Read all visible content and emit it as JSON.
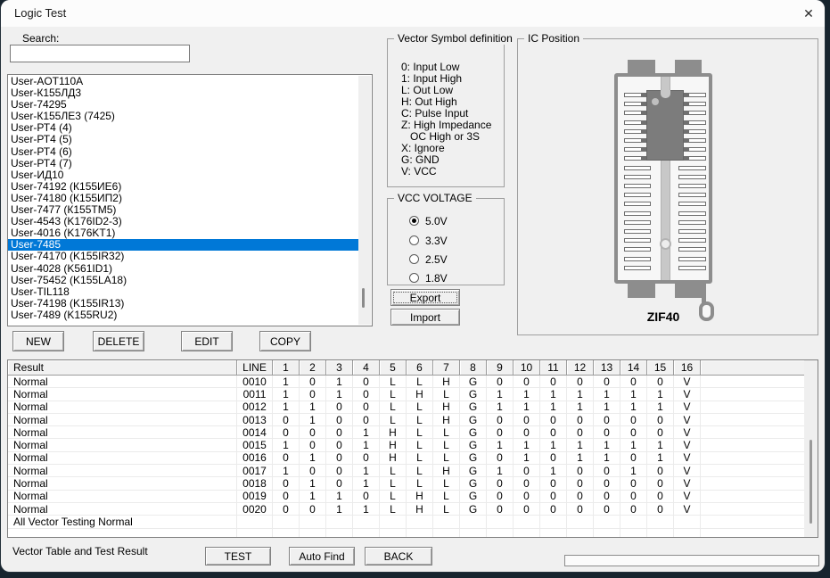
{
  "window": {
    "title": "Logic Test",
    "close_icon": "✕"
  },
  "search": {
    "label": "Search:",
    "value": ""
  },
  "chip_list": {
    "selected_index": 14,
    "items": [
      "User-AOT110A",
      "User-К155ЛД3",
      "User-74295",
      "User-К155ЛЕ3 (7425)",
      "User-РТ4 (4)",
      "User-РТ4 (5)",
      "User-РТ4 (6)",
      "User-РТ4 (7)",
      "User-ИД10",
      "User-74192 (К155ИЕ6)",
      "User-74180 (К155ИП2)",
      "User-7477 (К155ТМ5)",
      "User-4543 (K176ID2-3)",
      "User-4016 (K176KT1)",
      "User-7485",
      "User-74170 (K155IR32)",
      "User-4028 (K561ID1)",
      "User-75452 (K155LA18)",
      "User-TIL118",
      "User-74198 (K155IR13)",
      "User-7489 (K155RU2)"
    ]
  },
  "list_actions": {
    "new": "NEW",
    "delete": "DELETE",
    "edit": "EDIT",
    "copy": "COPY"
  },
  "vector_symbols": {
    "title": "Vector Symbol definition",
    "lines": [
      "0: Input Low",
      "1: Input High",
      "L: Out Low",
      "H: Out High",
      "C: Pulse Input",
      "Z: High Impedance",
      "   OC High or 3S",
      "X: Ignore",
      "G: GND",
      "V: VCC"
    ]
  },
  "vcc": {
    "title": "VCC VOLTAGE",
    "options": [
      "5.0V",
      "3.3V",
      "2.5V",
      "1.8V"
    ],
    "selected": "5.0V"
  },
  "io_buttons": {
    "export": "Export",
    "import": "Import"
  },
  "ic_position": {
    "title": "IC Position",
    "socket_label": "ZIF40",
    "pins_per_side": 20,
    "chip_pin_rows": 8
  },
  "vector_table": {
    "result_header": "Result",
    "line_header": "LINE",
    "pin_headers": [
      "1",
      "2",
      "3",
      "4",
      "5",
      "6",
      "7",
      "8",
      "9",
      "10",
      "11",
      "12",
      "13",
      "14",
      "15",
      "16"
    ],
    "rows": [
      {
        "result": "Normal",
        "line": "0010",
        "values": [
          "1",
          "0",
          "1",
          "0",
          "L",
          "L",
          "H",
          "G",
          "0",
          "0",
          "0",
          "0",
          "0",
          "0",
          "0",
          "V"
        ]
      },
      {
        "result": "Normal",
        "line": "0011",
        "values": [
          "1",
          "0",
          "1",
          "0",
          "L",
          "H",
          "L",
          "G",
          "1",
          "1",
          "1",
          "1",
          "1",
          "1",
          "1",
          "V"
        ]
      },
      {
        "result": "Normal",
        "line": "0012",
        "values": [
          "1",
          "1",
          "0",
          "0",
          "L",
          "L",
          "H",
          "G",
          "1",
          "1",
          "1",
          "1",
          "1",
          "1",
          "1",
          "V"
        ]
      },
      {
        "result": "Normal",
        "line": "0013",
        "values": [
          "0",
          "1",
          "0",
          "0",
          "L",
          "L",
          "H",
          "G",
          "0",
          "0",
          "0",
          "0",
          "0",
          "0",
          "0",
          "V"
        ]
      },
      {
        "result": "Normal",
        "line": "0014",
        "values": [
          "0",
          "0",
          "0",
          "1",
          "H",
          "L",
          "L",
          "G",
          "0",
          "0",
          "0",
          "0",
          "0",
          "0",
          "0",
          "V"
        ]
      },
      {
        "result": "Normal",
        "line": "0015",
        "values": [
          "1",
          "0",
          "0",
          "1",
          "H",
          "L",
          "L",
          "G",
          "1",
          "1",
          "1",
          "1",
          "1",
          "1",
          "1",
          "V"
        ]
      },
      {
        "result": "Normal",
        "line": "0016",
        "values": [
          "0",
          "1",
          "0",
          "0",
          "H",
          "L",
          "L",
          "G",
          "0",
          "1",
          "0",
          "1",
          "1",
          "0",
          "1",
          "V"
        ]
      },
      {
        "result": "Normal",
        "line": "0017",
        "values": [
          "1",
          "0",
          "0",
          "1",
          "L",
          "L",
          "H",
          "G",
          "1",
          "0",
          "1",
          "0",
          "0",
          "1",
          "0",
          "V"
        ]
      },
      {
        "result": "Normal",
        "line": "0018",
        "values": [
          "0",
          "1",
          "0",
          "1",
          "L",
          "L",
          "L",
          "G",
          "0",
          "0",
          "0",
          "0",
          "0",
          "0",
          "0",
          "V"
        ]
      },
      {
        "result": "Normal",
        "line": "0019",
        "values": [
          "0",
          "1",
          "1",
          "0",
          "L",
          "H",
          "L",
          "G",
          "0",
          "0",
          "0",
          "0",
          "0",
          "0",
          "0",
          "V"
        ]
      },
      {
        "result": "Normal",
        "line": "0020",
        "values": [
          "0",
          "0",
          "1",
          "1",
          "L",
          "H",
          "L",
          "G",
          "0",
          "0",
          "0",
          "0",
          "0",
          "0",
          "0",
          "V"
        ]
      }
    ],
    "summary_row": "All Vector Testing Normal"
  },
  "footer": {
    "caption": "Vector Table and Test Result",
    "test": "TEST",
    "auto_find": "Auto Find",
    "back": "BACK",
    "progress_percent": 0
  }
}
